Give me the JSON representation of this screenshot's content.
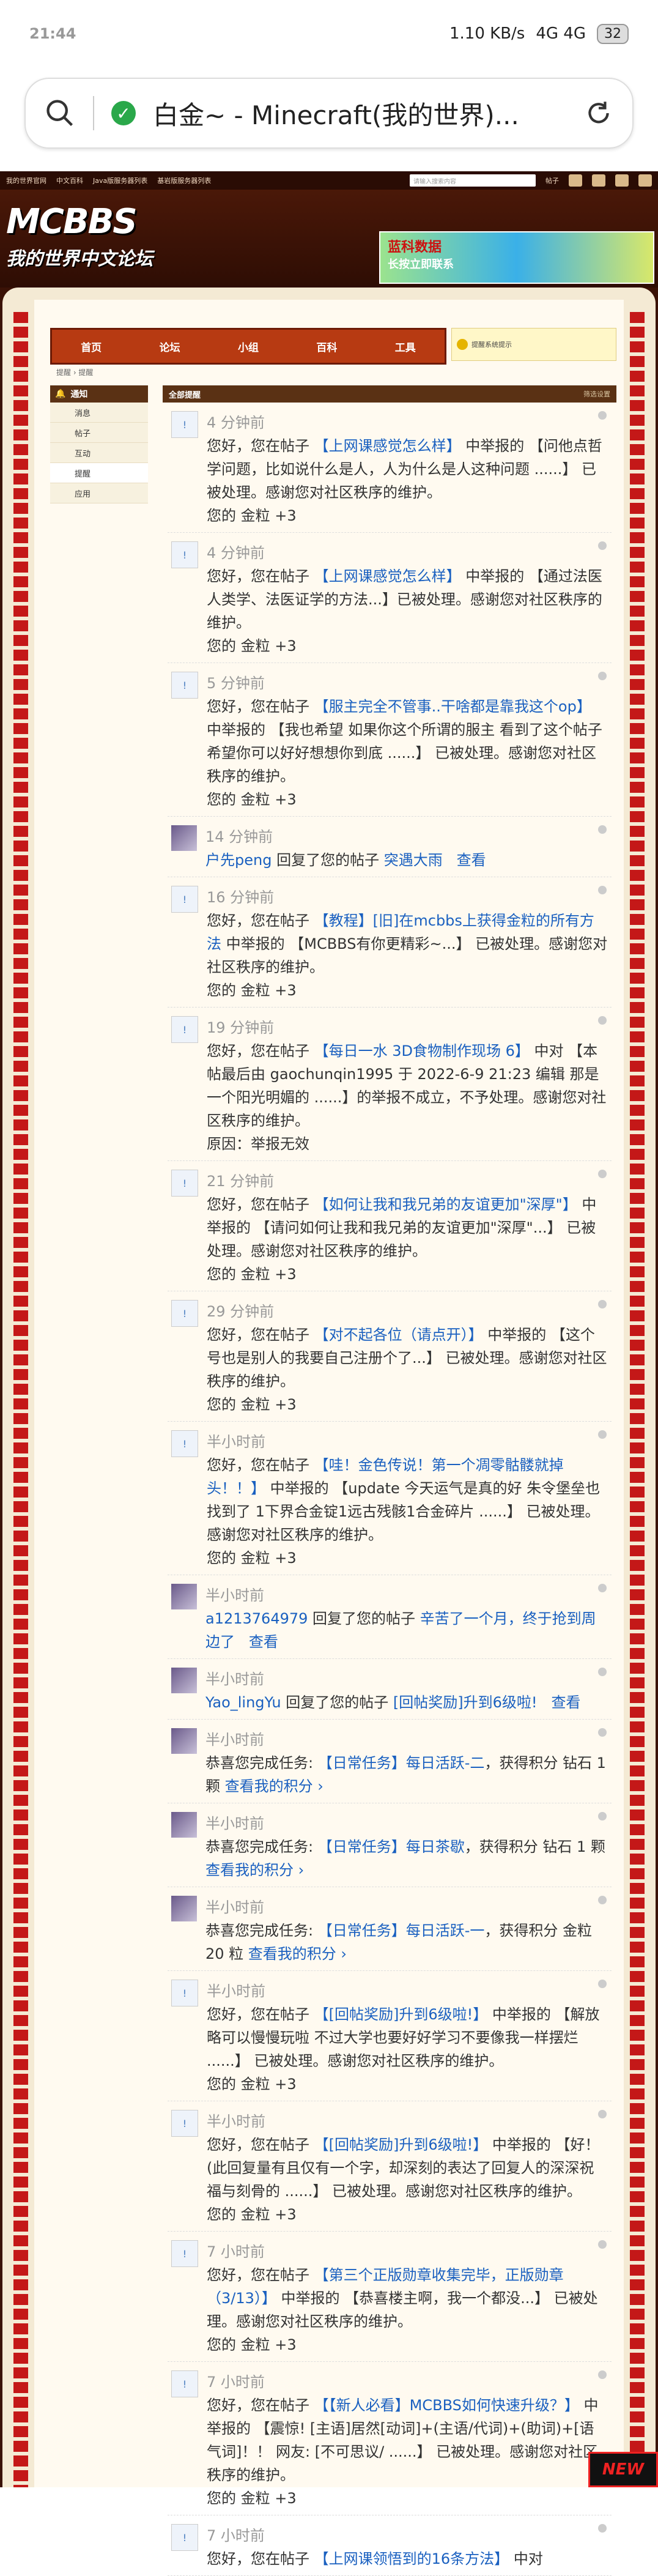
{
  "status": {
    "time": "21:44",
    "signal": "4G 4G",
    "net": "1.10 KB/s",
    "battery": "32"
  },
  "browser": {
    "title": "白金~ - Minecraft(我的世界)..."
  },
  "site": {
    "topnav": [
      "我的世界官网",
      "中文百科",
      "Java版服务器列表",
      "基岩版服务器列表"
    ],
    "search_placeholder": "请输入搜索内容",
    "search_scope": "帖子",
    "logo": "MCBBS",
    "logo_sub": "我的世界中文论坛",
    "ad_line1": "蓝科数据",
    "ad_line2": "长按立即联系",
    "mainnav": [
      "首页",
      "论坛",
      "小组",
      "百科",
      "工具"
    ],
    "notice": "提醒系统提示",
    "breadcrumb": "提醒 › 提醒",
    "sidebar_title": "通知",
    "sidebar_items": [
      "消息",
      "帖子",
      "互动",
      "提醒",
      "应用"
    ],
    "content_title": "全部提醒",
    "content_right": "筛选设置"
  },
  "feed": [
    {
      "type": "icon",
      "time": "4 分钟前",
      "pre": "您好，您在帖子 ",
      "link": "【上网课感觉怎么样】",
      "post": " 中举报的 【问他点哲学问题，比如说什么是人，人为什么是人这种问题 ......】 已被处理。感谢您对社区秩序的维护。",
      "extra": "您的 金粒 +3"
    },
    {
      "type": "icon",
      "time": "4 分钟前",
      "pre": "您好，您在帖子 ",
      "link": "【上网课感觉怎么样】",
      "post": " 中举报的 【通过法医人类学、法医证学的方法...】已被处理。感谢您对社区秩序的维护。",
      "extra": "您的 金粒 +3"
    },
    {
      "type": "icon",
      "time": "5 分钟前",
      "pre": "您好，您在帖子 ",
      "link": "【服主完全不管事..干啥都是靠我这个op】",
      "post": " 中举报的 【我也希望 如果你这个所谓的服主 看到了这个帖子 希望你可以好好想想你到底 ......】 已被处理。感谢您对社区秩序的维护。",
      "extra": "您的 金粒 +3"
    },
    {
      "type": "avatar",
      "time": "14 分钟前",
      "pre": "",
      "link": "户先peng",
      "post": " 回复了您的帖子 ",
      "link2": "突遇大雨",
      "post2": "",
      "view": "查看",
      "extra": ""
    },
    {
      "type": "icon",
      "time": "16 分钟前",
      "pre": "您好，您在帖子 ",
      "link": "【教程】[旧]在mcbbs上获得金粒的所有方法",
      "post": " 中举报的 【MCBBS有你更精彩~...】 已被处理。感谢您对社区秩序的维护。",
      "extra": "您的 金粒 +3"
    },
    {
      "type": "icon",
      "time": "19 分钟前",
      "pre": "您好，您在帖子 ",
      "link": "【每日一水 3D食物制作现场 6】",
      "post": " 中对 【本帖最后由 gaochunqin1995 于 2022-6-9 21:23 编辑 那是一个阳光明媚的 ......】的举报不成立，不予处理。感谢您对社区秩序的维护。",
      "extra": "原因：举报无效"
    },
    {
      "type": "icon",
      "time": "21 分钟前",
      "pre": "您好，您在帖子 ",
      "link": "【如何让我和我兄弟的友谊更加\"深厚\"】",
      "post": " 中举报的 【请问如何让我和我兄弟的友谊更加\"深厚\"...】 已被处理。感谢您对社区秩序的维护。",
      "extra": "您的 金粒 +3"
    },
    {
      "type": "icon",
      "time": "29 分钟前",
      "pre": "您好，您在帖子 ",
      "link": "【对不起各位（请点开）】",
      "post": " 中举报的 【这个号也是别人的我要自己注册个了...】 已被处理。感谢您对社区秩序的维护。",
      "extra": "您的 金粒 +3"
    },
    {
      "type": "icon",
      "time": "半小时前",
      "pre": "您好，您在帖子 ",
      "link": "【哇！金色传说！第一个凋零骷髅就掉头！！】",
      "post": " 中举报的 【update 今天运气是真的好 朱令堡垒也找到了 1下界合金锭1远古残骸1合金碎片 ......】 已被处理。感谢您对社区秩序的维护。",
      "extra": "您的 金粒 +3"
    },
    {
      "type": "avatar",
      "time": "半小时前",
      "pre": "",
      "link": "a1213764979",
      "post": " 回复了您的帖子 ",
      "link2": "辛苦了一个月，终于抢到周边了",
      "post2": "",
      "view": "查看",
      "extra": ""
    },
    {
      "type": "avatar",
      "time": "半小时前",
      "pre": "",
      "link": "Yao_lingYu",
      "post": " 回复了您的帖子 ",
      "link2": "[回帖奖励]升到6级啦!",
      "post2": "",
      "view": "查看",
      "extra": ""
    },
    {
      "type": "avatar",
      "time": "半小时前",
      "pre": "恭喜您完成任务: ",
      "link": "【日常任务】每日活跃-二",
      "post": "，获得积分 钻石 1 颗 ",
      "link2": "查看我的积分 ›",
      "post2": "",
      "extra": ""
    },
    {
      "type": "avatar",
      "time": "半小时前",
      "pre": "恭喜您完成任务: ",
      "link": "【日常任务】每日茶歇",
      "post": "，获得积分 钻石 1 颗 ",
      "link2": "查看我的积分 ›",
      "post2": "",
      "extra": ""
    },
    {
      "type": "avatar",
      "time": "半小时前",
      "pre": "恭喜您完成任务: ",
      "link": "【日常任务】每日活跃-一",
      "post": "，获得积分 金粒 20 粒 ",
      "link2": "查看我的积分 ›",
      "post2": "",
      "extra": ""
    },
    {
      "type": "icon",
      "time": "半小时前",
      "pre": "您好，您在帖子 ",
      "link": "【[回帖奖励]升到6级啦!】",
      "post": " 中举报的 【解放略可以慢慢玩啦 不过大学也要好好学习不要像我一样摆烂 ......】 已被处理。感谢您对社区秩序的维护。",
      "extra": "您的 金粒 +3"
    },
    {
      "type": "icon",
      "time": "半小时前",
      "pre": "您好，您在帖子 ",
      "link": "【[回帖奖励]升到6级啦!】",
      "post": " 中举报的 【好！ (此回复量有且仅有一个字，却深刻的表达了回复人的深深祝福与刻骨的 ......】 已被处理。感谢您对社区秩序的维护。",
      "extra": "您的 金粒 +3"
    },
    {
      "type": "icon",
      "time": "7 小时前",
      "pre": "您好，您在帖子 ",
      "link": "【第三个正版勋章收集完毕，正版勋章（3/13）】",
      "post": " 中举报的 【恭喜楼主啊，我一个都没...】 已被处理。感谢您对社区秩序的维护。",
      "extra": "您的 金粒 +3"
    },
    {
      "type": "icon",
      "time": "7 小时前",
      "pre": "您好，您在帖子 ",
      "link": "【【新人必看】MCBBS如何快速升级？】",
      "post": " 中举报的 【震惊! [主语]居然[动词]+(主语/代词)+(助词)+[语气词]！！ 网友: [不可思议/ ......】 已被处理。感谢您对社区秩序的维护。",
      "extra": "您的 金粒 +3"
    },
    {
      "type": "icon",
      "time": "7 小时前",
      "pre": "您好，您在帖子 ",
      "link": "【上网课领悟到的16条方法】",
      "post": " 中对",
      "extra": ""
    }
  ],
  "badge": "NEW"
}
